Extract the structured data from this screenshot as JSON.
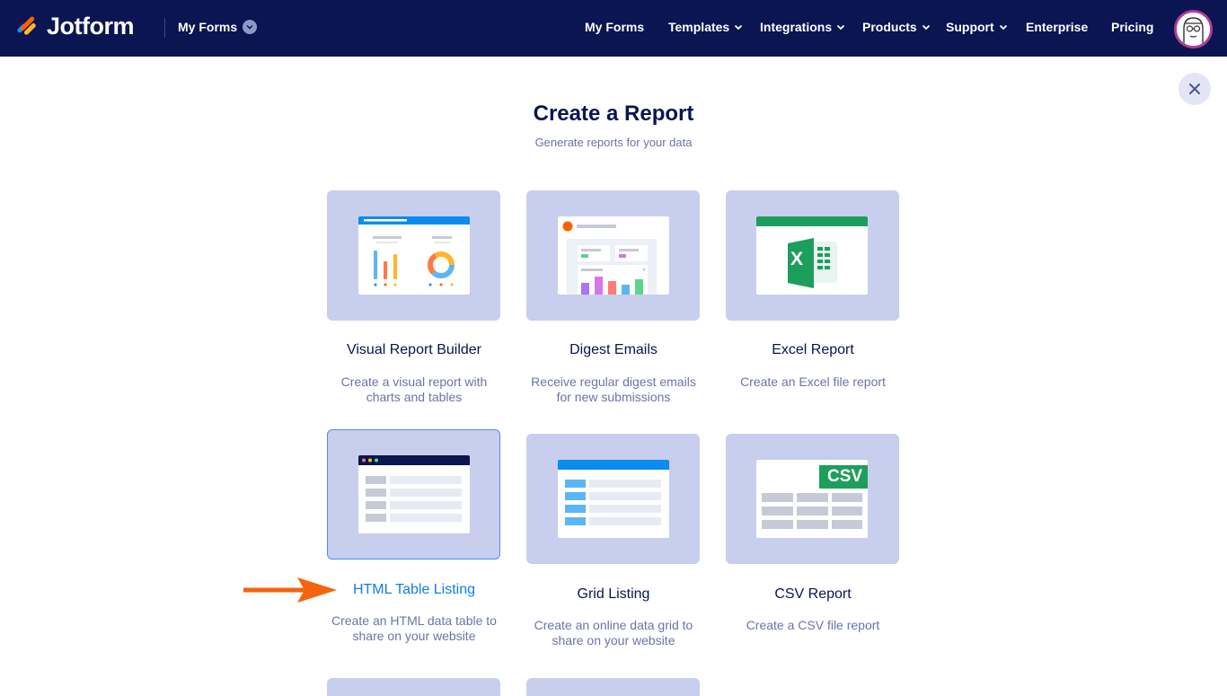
{
  "header": {
    "brand": "Jotform",
    "myforms_dropdown": "My Forms",
    "nav": [
      {
        "label": "My Forms",
        "has_chevron": false
      },
      {
        "label": "Templates",
        "has_chevron": true
      },
      {
        "label": "Integrations",
        "has_chevron": true
      },
      {
        "label": "Products",
        "has_chevron": true
      },
      {
        "label": "Support",
        "has_chevron": true
      },
      {
        "label": "Enterprise",
        "has_chevron": false
      },
      {
        "label": "Pricing",
        "has_chevron": false
      }
    ]
  },
  "page": {
    "title": "Create a Report",
    "subtitle": "Generate reports for your data"
  },
  "cards": [
    {
      "label": "Visual Report Builder",
      "desc1": "Create a visual report with",
      "desc2": "charts and tables",
      "selected": false
    },
    {
      "label": "Digest Emails",
      "desc1": "Receive regular digest emails",
      "desc2": "for new submissions",
      "selected": false
    },
    {
      "label": "Excel Report",
      "desc1": "Create an Excel file report",
      "desc2": "",
      "selected": false
    },
    {
      "label": "HTML Table Listing",
      "desc1": "Create an HTML data table to",
      "desc2": "share on your website",
      "selected": true
    },
    {
      "label": "Grid Listing",
      "desc1": "Create an online data grid to",
      "desc2": "share on your website",
      "selected": false
    },
    {
      "label": "CSV Report",
      "desc1": "Create a CSV file report",
      "desc2": "",
      "selected": false
    }
  ],
  "csv_badge": "CSV",
  "excel_badge": "X",
  "colors": {
    "navy": "#0a1551",
    "card_bg": "#c8ceed",
    "selected_blue": "#0f7ee8",
    "arrow": "#f2650e",
    "excel_green": "#1d9f5c"
  }
}
